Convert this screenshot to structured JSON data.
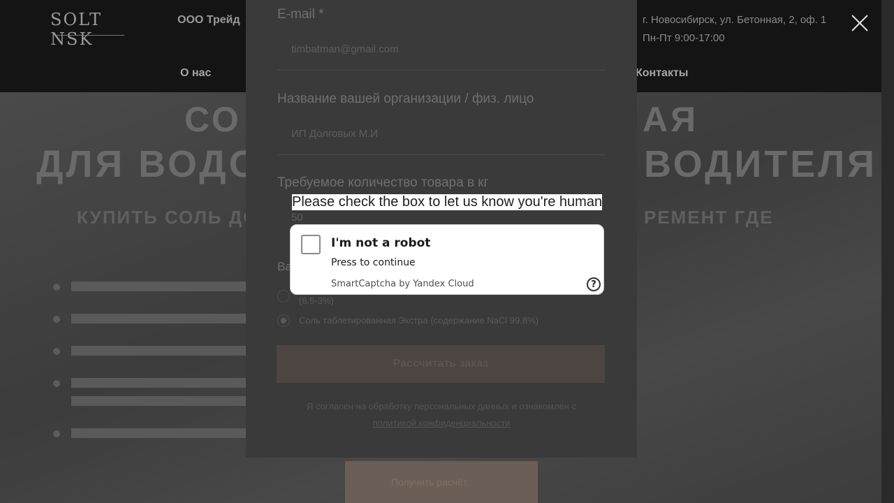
{
  "background": {
    "header": {
      "logo": "SOLT NSK",
      "logo_sub": "",
      "company": "ООО Трейд",
      "company_sub": "",
      "address": "г. Новосибирск, ул. Бетонная, 2, оф. 1",
      "hours": "Пн-Пт 9:00-17:00",
      "nav_about": "О нас",
      "nav_contacts": "Контакты"
    },
    "hero": {
      "line1_left": "СО",
      "line1_right": "АЯ",
      "line2_left": "ДЛЯ ВОДО",
      "line2_right": "ВОДИТЕЛЯ",
      "line3_left": "КУПИТЬ СОЛЬ ДО",
      "line3_right": "РЕМЕНТ ГДЕ"
    },
    "cta_button": "Получить расчёт"
  },
  "form": {
    "email_label": "E-mail *",
    "email_value": "timbatman@gmail.com",
    "org_label": "Название вашей организации / физ. лицо",
    "org_value": "ИП Долговых М.И",
    "qty_label": "Требуемое количество товара в кг",
    "qty_value": "50",
    "product_label": "Ва",
    "radio_option_1": "(6.5-3%)",
    "radio_option_2": "Соль таблетированная Экстра (содержание NaCl 99.8%)",
    "submit_label": "Рассчитать заказ",
    "consent_text": "Я согласен на обработку персональных данных и ознакомлен с",
    "consent_link": "политикой конфиденциальности"
  },
  "captcha": {
    "prompt": "Please check the box to let us know you're human",
    "checkbox_label": "I'm not a robot",
    "subtitle": "Press to continue",
    "brand": "SmartCaptcha by Yandex Cloud",
    "help_glyph": "?"
  },
  "colors": {
    "overlay": "#3a3a3a",
    "captcha_bg": "#ffffff",
    "captcha_border": "#cfcfcf"
  }
}
